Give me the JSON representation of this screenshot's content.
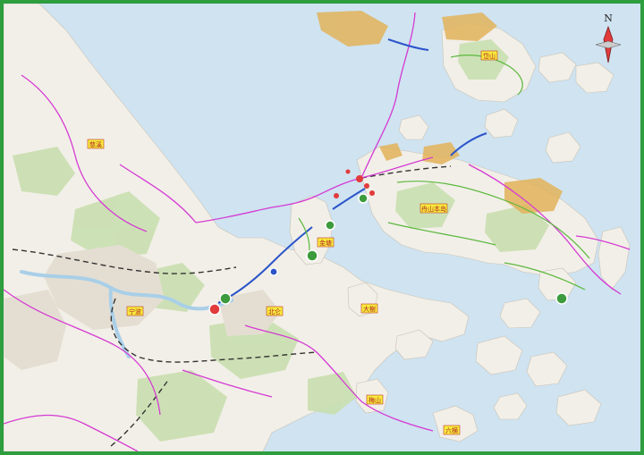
{
  "compass": {
    "letter": "N"
  },
  "labels": {
    "cixi": "慈溪",
    "ningbo": "宁波",
    "beilun": "北仑",
    "jintang": "金塘",
    "zhoushan": "舟山本岛",
    "daishan": "岱山",
    "daxie": "大榭",
    "meishan": "梅山",
    "liuheng": "六横"
  },
  "colors": {
    "sea": "#cfe3f1",
    "land": "#f2efe8",
    "green_area": "#c9dfb0",
    "urban": "#e4ded2",
    "water_river": "#a9cfe8",
    "frame": "#2e9e3e",
    "magenta_line": "#d53ad3",
    "blue_line": "#2b54c9",
    "green_line": "#5ab83c",
    "rail_dash": "#333333",
    "sandbar": "#e2b35a",
    "label_fill": "#f7ea3b",
    "label_stroke": "#c0392b"
  }
}
